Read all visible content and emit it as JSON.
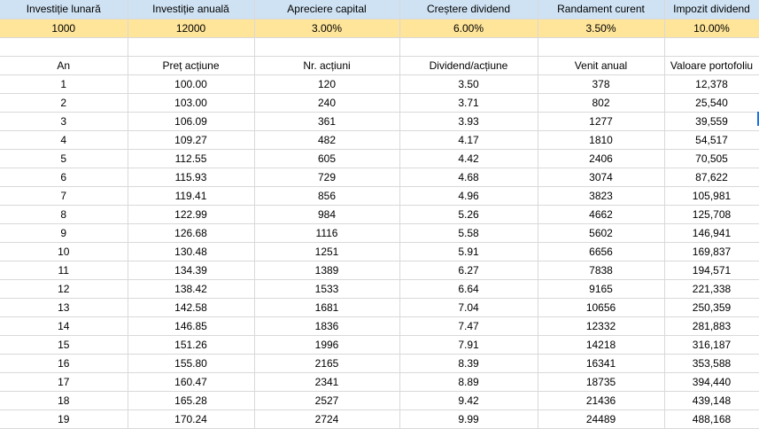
{
  "params": {
    "headers": [
      "Investiție lunară",
      "Investiție anuală",
      "Apreciere capital",
      "Creștere dividend",
      "Randament curent",
      "Impozit dividend"
    ],
    "values": [
      "1000",
      "12000",
      "3.00%",
      "6.00%",
      "3.50%",
      "10.00%"
    ]
  },
  "table": {
    "columns": [
      "An",
      "Preț acțiune",
      "Nr. acțiuni",
      "Dividend/acțiune",
      "Venit anual",
      "Valoare portofoliu"
    ],
    "rows": [
      [
        "1",
        "100.00",
        "120",
        "3.50",
        "378",
        "12,378"
      ],
      [
        "2",
        "103.00",
        "240",
        "3.71",
        "802",
        "25,540"
      ],
      [
        "3",
        "106.09",
        "361",
        "3.93",
        "1277",
        "39,559"
      ],
      [
        "4",
        "109.27",
        "482",
        "4.17",
        "1810",
        "54,517"
      ],
      [
        "5",
        "112.55",
        "605",
        "4.42",
        "2406",
        "70,505"
      ],
      [
        "6",
        "115.93",
        "729",
        "4.68",
        "3074",
        "87,622"
      ],
      [
        "7",
        "119.41",
        "856",
        "4.96",
        "3823",
        "105,981"
      ],
      [
        "8",
        "122.99",
        "984",
        "5.26",
        "4662",
        "125,708"
      ],
      [
        "9",
        "126.68",
        "1116",
        "5.58",
        "5602",
        "146,941"
      ],
      [
        "10",
        "130.48",
        "1251",
        "5.91",
        "6656",
        "169,837"
      ],
      [
        "11",
        "134.39",
        "1389",
        "6.27",
        "7838",
        "194,571"
      ],
      [
        "12",
        "138.42",
        "1533",
        "6.64",
        "9165",
        "221,338"
      ],
      [
        "13",
        "142.58",
        "1681",
        "7.04",
        "10656",
        "250,359"
      ],
      [
        "14",
        "146.85",
        "1836",
        "7.47",
        "12332",
        "281,883"
      ],
      [
        "15",
        "151.26",
        "1996",
        "7.91",
        "14218",
        "316,187"
      ],
      [
        "16",
        "155.80",
        "2165",
        "8.39",
        "16341",
        "353,588"
      ],
      [
        "17",
        "160.47",
        "2341",
        "8.89",
        "18735",
        "394,440"
      ],
      [
        "18",
        "165.28",
        "2527",
        "9.42",
        "21436",
        "439,148"
      ],
      [
        "19",
        "170.24",
        "2724",
        "9.99",
        "24489",
        "488,168"
      ]
    ]
  },
  "colors": {
    "header_fill": "#cfe2f3",
    "input_fill": "#ffe599",
    "gridline": "#d9d9d9",
    "selection_edge": "#1a73e8"
  }
}
